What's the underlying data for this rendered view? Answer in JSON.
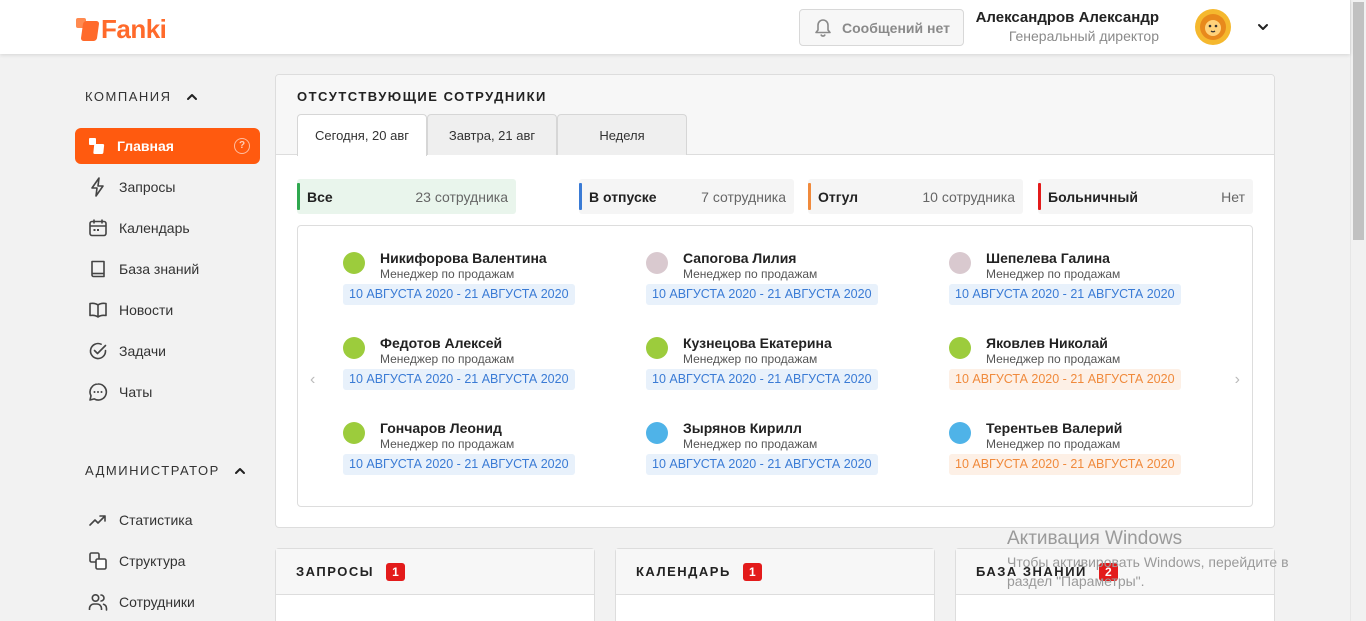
{
  "header": {
    "logo": "Fanki",
    "messages_label": "Сообщений нет",
    "user_name": "Александров Александр",
    "user_role": "Генеральный директор"
  },
  "sidebar": {
    "company_title": "КОМПАНИЯ",
    "company_items": [
      {
        "label": "Главная",
        "icon": "home-icon"
      },
      {
        "label": "Запросы",
        "icon": "lightning-icon"
      },
      {
        "label": "Календарь",
        "icon": "calendar-icon"
      },
      {
        "label": "База знаний",
        "icon": "book-icon"
      },
      {
        "label": "Новости",
        "icon": "open-book-icon"
      },
      {
        "label": "Задачи",
        "icon": "check-circle-icon"
      },
      {
        "label": "Чаты",
        "icon": "chat-icon"
      }
    ],
    "admin_title": "АДМИНИСТРАТОР",
    "admin_items": [
      {
        "label": "Статистика",
        "icon": "trend-icon"
      },
      {
        "label": "Структура",
        "icon": "structure-icon"
      },
      {
        "label": "Сотрудники",
        "icon": "users-icon"
      }
    ]
  },
  "absent": {
    "title": "ОТСУТСТВУЮЩИЕ СОТРУДНИКИ",
    "tabs": [
      "Сегодня, 20 авг",
      "Завтра, 21 авг",
      "Неделя"
    ],
    "filters": [
      {
        "label": "Все",
        "count": "23 сотрудника",
        "color": "#2fa84f"
      },
      {
        "label": "В отпуске",
        "count": "7 сотрудника",
        "color": "#3a7bd5"
      },
      {
        "label": "Отгул",
        "count": "10 сотрудника",
        "color": "#f08a3c"
      },
      {
        "label": "Больничный",
        "count": "Нет",
        "color": "#e31b1b"
      }
    ],
    "employees": [
      {
        "name": "Никифорова Валентина",
        "role": "Менеджер по продажам",
        "dates": "10 АВГУСТА 2020 - 21 АВГУСТА 2020",
        "type": "blue",
        "avatar_color": "#9ccc3c"
      },
      {
        "name": "Сапогова Лилия",
        "role": "Менеджер по продажам",
        "dates": "10 АВГУСТА 2020 - 21 АВГУСТА 2020",
        "type": "blue",
        "avatar_color": "#d9c9cf"
      },
      {
        "name": "Шепелева Галина",
        "role": "Менеджер по продажам",
        "dates": "10 АВГУСТА 2020 - 21 АВГУСТА 2020",
        "type": "blue",
        "avatar_color": "#d9c9cf"
      },
      {
        "name": "Федотов Алексей",
        "role": "Менеджер по продажам",
        "dates": "10 АВГУСТА 2020 - 21 АВГУСТА 2020",
        "type": "blue",
        "avatar_color": "#9ccc3c"
      },
      {
        "name": "Кузнецова Екатерина",
        "role": "Менеджер по продажам",
        "dates": "10 АВГУСТА 2020 - 21 АВГУСТА 2020",
        "type": "blue",
        "avatar_color": "#9ccc3c"
      },
      {
        "name": "Яковлев Николай",
        "role": "Менеджер по продажам",
        "dates": "10 АВГУСТА 2020 - 21 АВГУСТА 2020",
        "type": "orange",
        "avatar_color": "#9ccc3c"
      },
      {
        "name": "Гончаров Леонид",
        "role": "Менеджер по продажам",
        "dates": "10 АВГУСТА 2020 - 21 АВГУСТА 2020",
        "type": "blue",
        "avatar_color": "#9ccc3c"
      },
      {
        "name": "Зырянов Кирилл",
        "role": "Менеджер по продажам",
        "dates": "10 АВГУСТА 2020 - 21 АВГУСТА 2020",
        "type": "blue",
        "avatar_color": "#4fb3e8"
      },
      {
        "name": "Терентьев Валерий",
        "role": "Менеджер по продажам",
        "dates": "10 АВГУСТА 2020 - 21 АВГУСТА 2020",
        "type": "orange",
        "avatar_color": "#4fb3e8"
      }
    ]
  },
  "cards": [
    {
      "title": "ЗАПРОСЫ",
      "badge": "1"
    },
    {
      "title": "КАЛЕНДАРЬ",
      "badge": "1"
    },
    {
      "title": "БАЗА ЗНАНИЙ",
      "badge": "2"
    }
  ],
  "watermark": {
    "title": "Активация Windows",
    "text": "Чтобы активировать Windows, перейдите в раздел \"Параметры\"."
  }
}
